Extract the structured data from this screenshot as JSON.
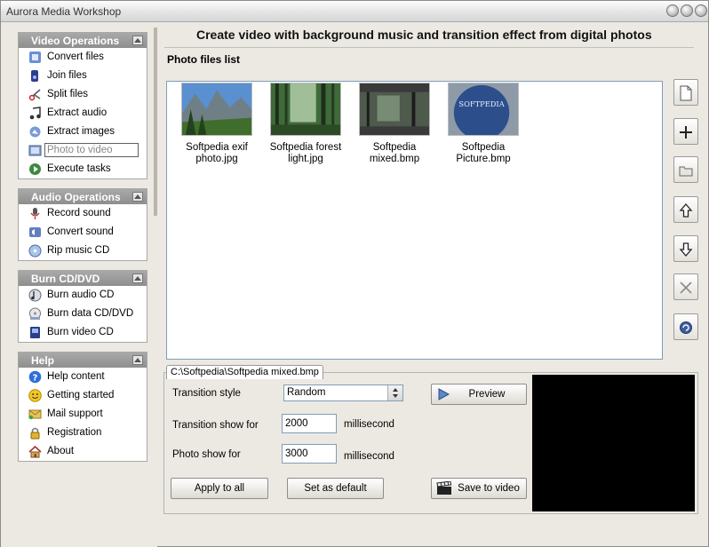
{
  "window": {
    "title": "Aurora Media Workshop"
  },
  "header": {
    "title": "Create video with background music and transition effect from digital photos"
  },
  "panels": {
    "video": {
      "title": "Video Operations",
      "items": [
        "Convert files",
        "Join files",
        "Split files",
        "Extract audio",
        "Extract images",
        "Photo to video",
        "Execute tasks"
      ],
      "active": "Photo to video"
    },
    "audio": {
      "title": "Audio Operations",
      "items": [
        "Record sound",
        "Convert sound",
        "Rip music CD"
      ]
    },
    "burn": {
      "title": "Burn CD/DVD",
      "items": [
        "Burn audio CD",
        "Burn data CD/DVD",
        "Burn video CD"
      ]
    },
    "help": {
      "title": "Help",
      "items": [
        "Help content",
        "Getting started",
        "Mail support",
        "Registration",
        "About"
      ]
    }
  },
  "photo_list": {
    "title": "Photo files list",
    "files": [
      {
        "caption_line1": "Softpedia exif",
        "caption_line2": "photo.jpg"
      },
      {
        "caption_line1": "Softpedia forest",
        "caption_line2": "light.jpg"
      },
      {
        "caption_line1": "Softpedia",
        "caption_line2": "mixed.bmp"
      },
      {
        "caption_line1": "Softpedia",
        "caption_line2": "Picture.bmp",
        "thumb_text": "SOFTPEDIA"
      }
    ]
  },
  "side_buttons": [
    "new-icon",
    "add-icon",
    "open-folder-icon",
    "move-up-icon",
    "move-down-icon",
    "delete-icon",
    "refresh-icon"
  ],
  "options": {
    "path": "C:\\Softpedia\\Softpedia mixed.bmp",
    "transition_style_label": "Transition style",
    "transition_style_value": "Random",
    "transition_show_label": "Transition show for",
    "transition_show_value": "2000",
    "photo_show_label": "Photo show for",
    "photo_show_value": "3000",
    "unit": "millisecond",
    "apply_all": "Apply to all",
    "set_default": "Set as default",
    "preview": "Preview",
    "save_video": "Save to video"
  },
  "colors": {
    "panel_header": "#9a9a9a",
    "preview_bg": "#000000"
  }
}
